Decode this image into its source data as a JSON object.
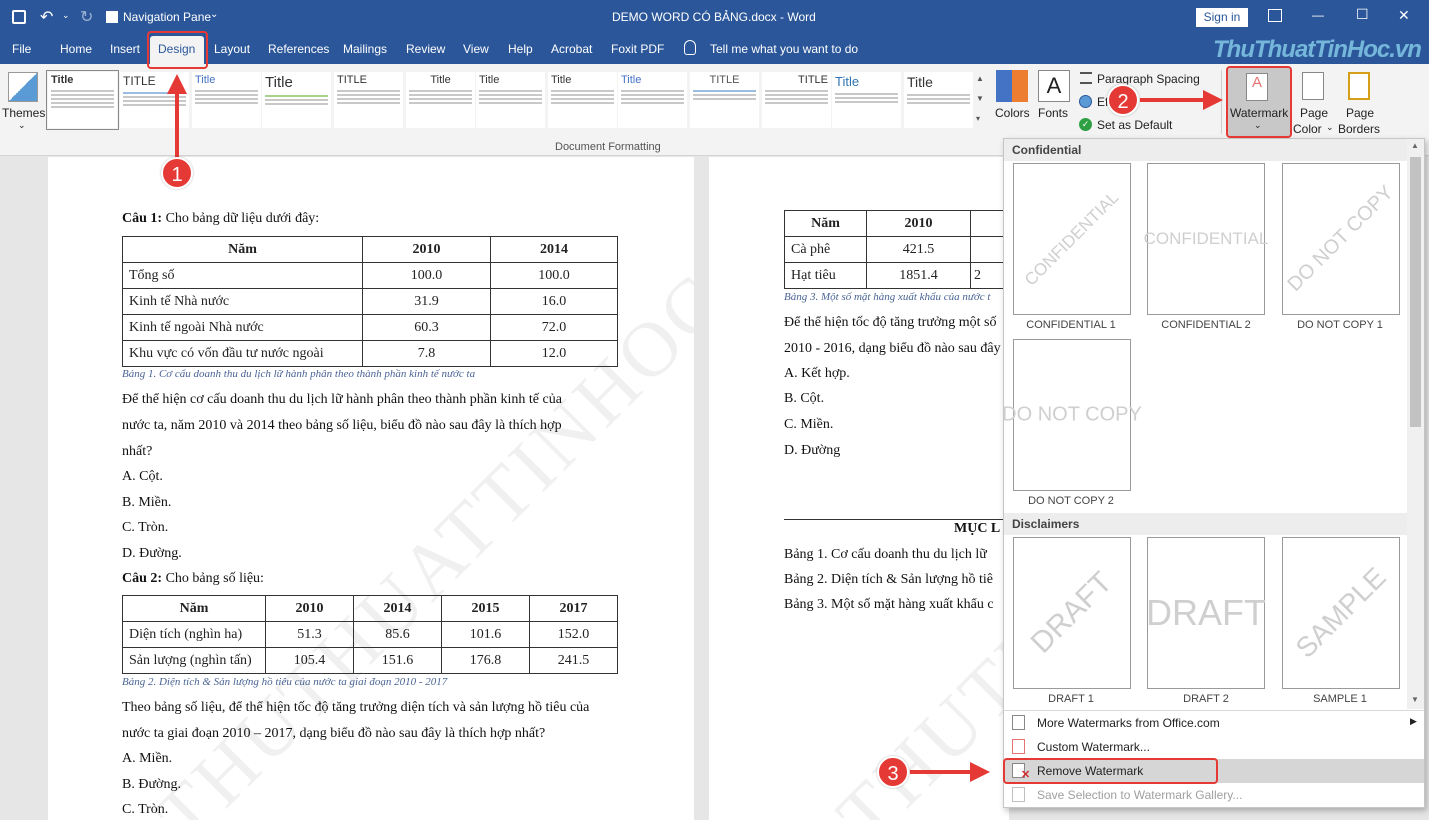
{
  "titlebar": {
    "nav_pane": "Navigation Pane",
    "doc_title": "DEMO WORD CÓ BẢNG.docx  -  Word",
    "sign_in": "Sign in",
    "minimize": "—",
    "restore": "☐",
    "close": "✕"
  },
  "tabs": [
    "File",
    "Home",
    "Insert",
    "Design",
    "Layout",
    "References",
    "Mailings",
    "Review",
    "View",
    "Help",
    "Acrobat",
    "Foxit PDF"
  ],
  "tell_me": "Tell me what you want to do",
  "watermark_brand": "ThuThuatTinHoc.vn",
  "ribbon": {
    "themes": "Themes",
    "style_heads": [
      "Title",
      "TITLE",
      "Title",
      "Title",
      "TITLE",
      "Title",
      "Title",
      "Title",
      "Title",
      "Title",
      "TITLE",
      "TITLE",
      "Title",
      "Title"
    ],
    "group_label": "Document Formatting",
    "colors": "Colors",
    "fonts": "Fonts",
    "paragraph_spacing": "Paragraph Spacing",
    "effects": "Eff",
    "set_default": "Set as Default",
    "watermark": "Watermark",
    "page_color_1": "Page",
    "page_color_2": "Color",
    "page_borders_1": "Page",
    "page_borders_2": "Borders"
  },
  "page1": {
    "q1_bold": "Câu 1:",
    "q1_rest": " Cho bảng dữ liệu dưới đây:",
    "t1_header": [
      "Năm",
      "2010",
      "2014"
    ],
    "t1_rows": [
      [
        "Tổng số",
        "100.0",
        "100.0"
      ],
      [
        "Kinh tế Nhà nước",
        "31.9",
        "16.0"
      ],
      [
        "Kinh tế ngoài Nhà nước",
        "60.3",
        "72.0"
      ],
      [
        "Khu vực có vốn đầu tư nước ngoài",
        "7.8",
        "12.0"
      ]
    ],
    "cap1": "Bảng 1. Cơ cấu doanh thu du lịch lữ hành phân theo thành phần kinh tế nước ta",
    "p1_l1": "Để thể hiện cơ cấu doanh thu du lịch lữ hành phân theo thành phần kinh tế của",
    "p1_l2": "nước ta, năm 2010 và 2014 theo bảng số liệu, biểu đồ nào sau đây là thích hợp",
    "p1_l3": "nhất?",
    "a1": "A. Cột.",
    "b1": "B. Miền.",
    "c1": "C. Tròn.",
    "d1": "D. Đường.",
    "q2_bold": "Câu 2:",
    "q2_rest": " Cho bảng số liệu:",
    "t2_header": [
      "Năm",
      "2010",
      "2014",
      "2015",
      "2017"
    ],
    "t2_rows": [
      [
        "Diện tích (nghìn ha)",
        "51.3",
        "85.6",
        "101.6",
        "152.0"
      ],
      [
        "Sản lượng (nghìn tấn)",
        "105.4",
        "151.6",
        "176.8",
        "241.5"
      ]
    ],
    "cap2": "Bảng 2. Diện tích & Sản lượng hồ tiêu của nước ta giai đoạn 2010 - 2017",
    "p2_l1": "Theo bảng số liệu, để thể hiện tốc độ tăng trưởng diện tích và sản lượng hồ tiêu của",
    "p2_l2": "nước ta giai đoạn 2010 – 2017, dạng biểu đồ nào sau đây là thích hợp nhất?",
    "a2": "A. Miền.",
    "b2": "B. Đường.",
    "c2": "C. Tròn.",
    "wm": "THUTHUATTINHOC"
  },
  "page2": {
    "t3_header": [
      "Năm",
      "2010"
    ],
    "t3_rows": [
      [
        "Cà phê",
        "421.5"
      ],
      [
        "Hạt tiêu",
        "1851.4"
      ]
    ],
    "t3_partial": "2",
    "cap3": "Bảng 3. Một số mặt hàng xuất khẩu của nước t",
    "p_l1": "Để thể hiện tốc độ tăng trưởng một số",
    "p_l2": "2010 - 2016, dạng biểu đồ nào sau đây",
    "a": "A. Kết hợp.",
    "b": "B. Cột.",
    "c": "C. Miền.",
    "d": "D. Đường",
    "toc_title": "MỤC L",
    "toc": [
      "Bảng 1. Cơ cấu doanh thu du lịch lữ",
      "Bảng 2. Diện tích & Sản lượng hồ tiê",
      "Bảng 3. Một số mặt hàng xuất khẩu c"
    ],
    "wm": "THUTHU"
  },
  "dropdown": {
    "sec1": "Confidential",
    "sec2": "Disclaimers",
    "thumbs1": [
      {
        "text": "CONFIDENTIAL",
        "label": "CONFIDENTIAL 1"
      },
      {
        "text": "CONFIDENTIAL",
        "label": "CONFIDENTIAL 2"
      },
      {
        "text": "DO NOT COPY",
        "label": "DO NOT COPY 1"
      },
      {
        "text": "DO NOT COPY",
        "label": "DO NOT COPY 2"
      }
    ],
    "thumbs2": [
      {
        "text": "DRAFT",
        "label": "DRAFT 1"
      },
      {
        "text": "DRAFT",
        "label": "DRAFT 2"
      },
      {
        "text": "SAMPLE",
        "label": "SAMPLE 1"
      }
    ],
    "more": "More Watermarks from Office.com",
    "custom": "Custom Watermark...",
    "remove": "Remove Watermark",
    "save_sel": "Save Selection to Watermark Gallery..."
  },
  "markers": [
    "1",
    "2",
    "3"
  ],
  "colors": {
    "word_blue": "#2b579a",
    "annot_red": "#e53935"
  }
}
